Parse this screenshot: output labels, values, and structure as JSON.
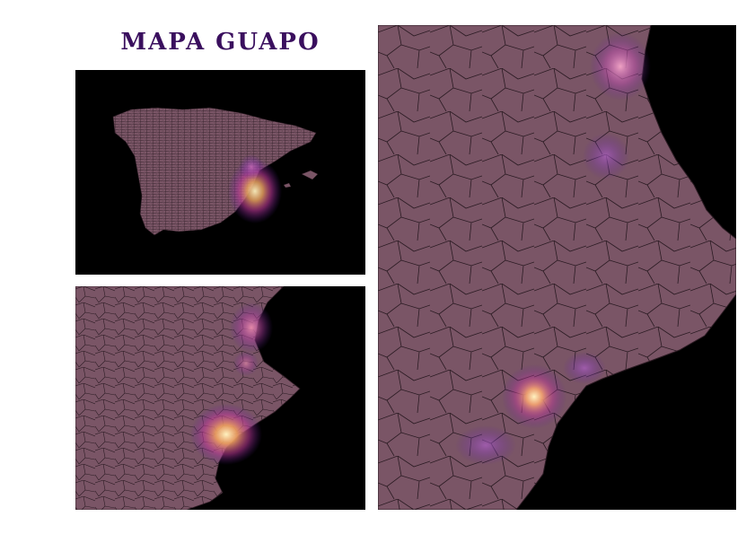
{
  "figure": {
    "title": "MAPA GUAPO"
  },
  "colors": {
    "background": "#ffffff",
    "title": "#3a0f5e",
    "sea": "#000000",
    "land": "#7a5566",
    "borders": "#2a1a22",
    "heat_low": "#7b2fbf",
    "heat_mid": "#e0609a",
    "heat_high": "#fff2c0"
  },
  "maps": {
    "overview": {
      "subject": "iberian-peninsula-municipalities"
    },
    "regional": {
      "subject": "valencian-coast-municipalities"
    },
    "zoom": {
      "subject": "valencia-alicante-murcia-municipalities"
    }
  }
}
